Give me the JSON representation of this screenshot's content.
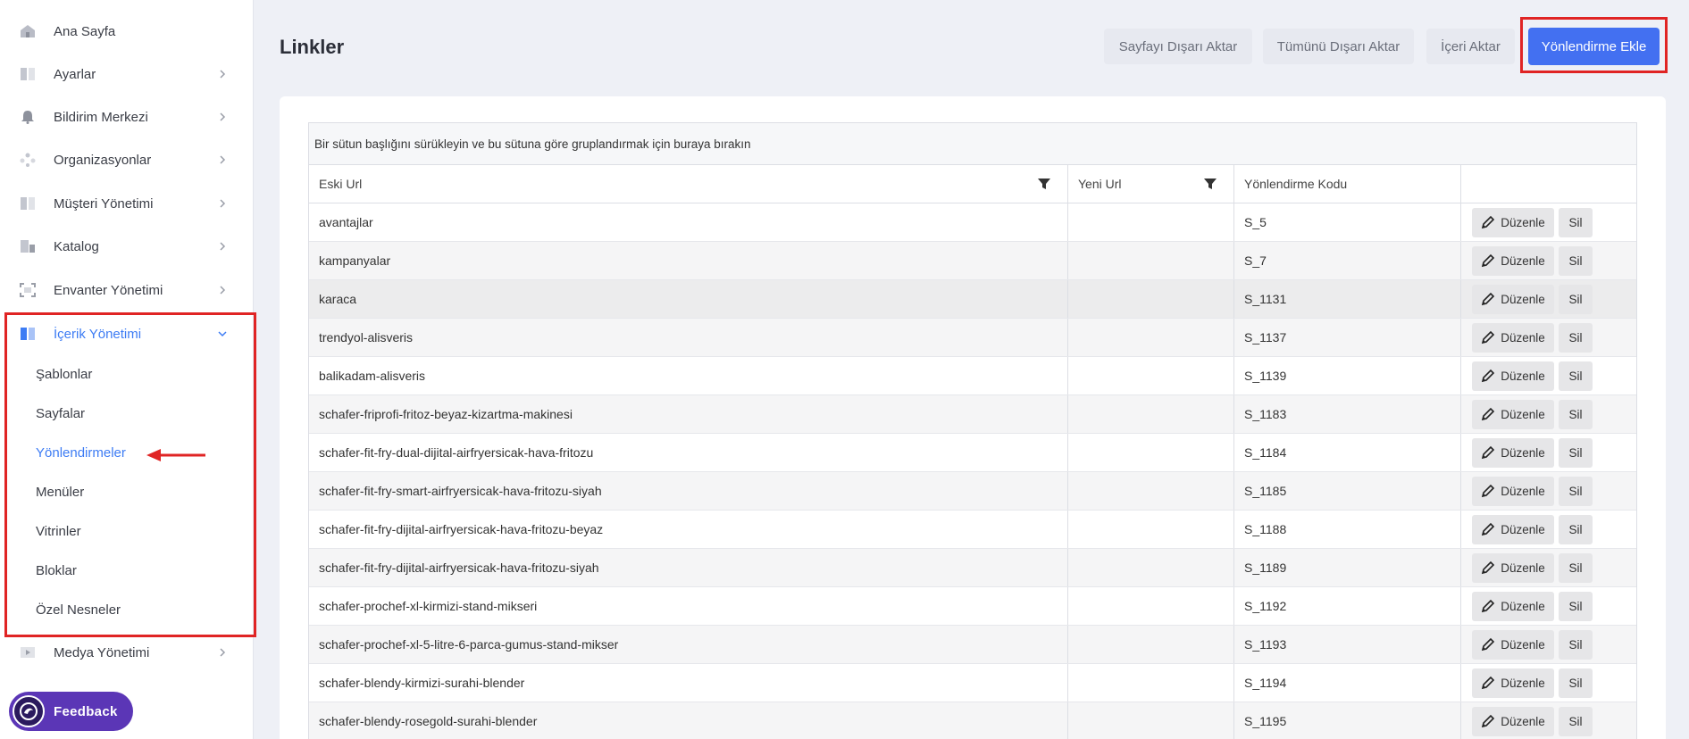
{
  "sidebar": {
    "items_top": [
      {
        "label": "Ana Sayfa",
        "icon": "home-icon",
        "chevron": false
      },
      {
        "label": "Ayarlar",
        "icon": "settings-panel-icon",
        "chevron": true
      },
      {
        "label": "Bildirim Merkezi",
        "icon": "bell-icon",
        "chevron": true
      },
      {
        "label": "Organizasyonlar",
        "icon": "org-icon",
        "chevron": true
      },
      {
        "label": "Müşteri Yönetimi",
        "icon": "customer-icon",
        "chevron": true
      },
      {
        "label": "Katalog",
        "icon": "catalog-icon",
        "chevron": true
      },
      {
        "label": "Envanter Yönetimi",
        "icon": "inventory-icon",
        "chevron": true
      }
    ],
    "active_section": {
      "label": "İçerik Yönetimi",
      "icon": "content-icon"
    },
    "sub_items": [
      "Şablonlar",
      "Sayfalar",
      "Yönlendirmeler",
      "Menüler",
      "Vitrinler",
      "Bloklar",
      "Özel Nesneler"
    ],
    "active_sub_index": 2,
    "bottom_item": {
      "label": "Medya Yönetimi",
      "icon": "media-icon"
    },
    "feedback_label": "Feedback"
  },
  "header": {
    "title": "Linkler",
    "export_page": "Sayfayı Dışarı Aktar",
    "export_all": "Tümünü Dışarı Aktar",
    "import": "İçeri Aktar",
    "add_redirect": "Yönlendirme Ekle"
  },
  "grid": {
    "group_panel_text": "Bir sütun başlığını sürükleyin ve bu sütuna göre gruplandırmak için buraya bırakın",
    "columns": [
      "Eski Url",
      "Yeni Url",
      "Yönlendirme Kodu",
      ""
    ],
    "edit_label": "Düzenle",
    "delete_label": "Sil",
    "rows": [
      {
        "old_url": "avantajlar",
        "new_url": "",
        "code": "S_5"
      },
      {
        "old_url": "kampanyalar",
        "new_url": "",
        "code": "S_7"
      },
      {
        "old_url": "karaca",
        "new_url": "",
        "code": "S_1131"
      },
      {
        "old_url": "trendyol-alisveris",
        "new_url": "",
        "code": "S_1137"
      },
      {
        "old_url": "balikadam-alisveris",
        "new_url": "",
        "code": "S_1139"
      },
      {
        "old_url": "schafer-friprofi-fritoz-beyaz-kizartma-makinesi",
        "new_url": "",
        "code": "S_1183"
      },
      {
        "old_url": "schafer-fit-fry-dual-dijital-airfryersicak-hava-fritozu",
        "new_url": "",
        "code": "S_1184"
      },
      {
        "old_url": "schafer-fit-fry-smart-airfryersicak-hava-fritozu-siyah",
        "new_url": "",
        "code": "S_1185"
      },
      {
        "old_url": "schafer-fit-fry-dijital-airfryersicak-hava-fritozu-beyaz",
        "new_url": "",
        "code": "S_1188"
      },
      {
        "old_url": "schafer-fit-fry-dijital-airfryersicak-hava-fritozu-siyah",
        "new_url": "",
        "code": "S_1189"
      },
      {
        "old_url": "schafer-prochef-xl-kirmizi-stand-mikseri",
        "new_url": "",
        "code": "S_1192"
      },
      {
        "old_url": "schafer-prochef-xl-5-litre-6-parca-gumus-stand-mikser",
        "new_url": "",
        "code": "S_1193"
      },
      {
        "old_url": "schafer-blendy-kirmizi-surahi-blender",
        "new_url": "",
        "code": "S_1194"
      },
      {
        "old_url": "schafer-blendy-rosegold-surahi-blender",
        "new_url": "",
        "code": "S_1195"
      }
    ]
  },
  "colors": {
    "accent": "#3d7cf4",
    "primary_button": "#4370f1",
    "highlight": "#e02424",
    "feedback": "#5b36b6"
  }
}
